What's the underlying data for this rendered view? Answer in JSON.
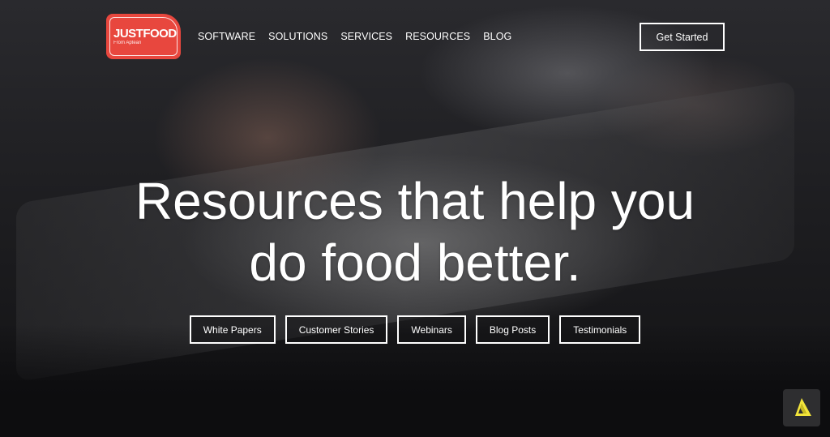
{
  "brand": {
    "name": "JUSTFOOD",
    "subtitle": "From Aptean",
    "color": "#e8473e"
  },
  "nav": {
    "items": [
      {
        "label": "SOFTWARE"
      },
      {
        "label": "SOLUTIONS"
      },
      {
        "label": "SERVICES"
      },
      {
        "label": "RESOURCES"
      },
      {
        "label": "BLOG"
      }
    ],
    "cta_label": "Get Started"
  },
  "hero": {
    "headline_line1": "Resources that help you",
    "headline_line2": "do food better."
  },
  "resource_filters": [
    {
      "label": "White Papers"
    },
    {
      "label": "Customer Stories"
    },
    {
      "label": "Webinars"
    },
    {
      "label": "Blog Posts"
    },
    {
      "label": "Testimonials"
    }
  ],
  "widget": {
    "icon": "aptean-logo-icon",
    "color": "#f2e43a"
  }
}
